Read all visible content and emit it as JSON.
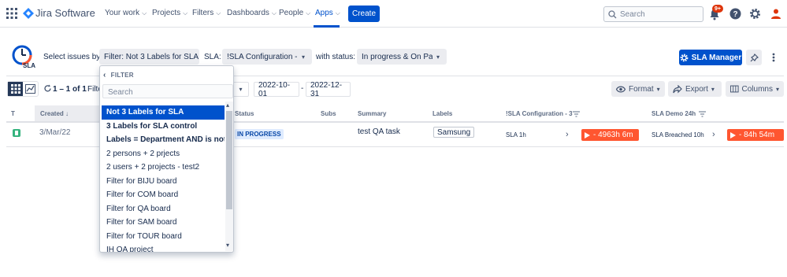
{
  "nav": {
    "app_name": "Jira Software",
    "items": [
      {
        "label": "Your work"
      },
      {
        "label": "Projects"
      },
      {
        "label": "Filters"
      },
      {
        "label": "Dashboards"
      },
      {
        "label": "People"
      },
      {
        "label": "Apps"
      }
    ],
    "create_label": "Create",
    "search_placeholder": "Search",
    "notification_badge": "9+",
    "brand_color": "#0052CC"
  },
  "toolbar": {
    "logo_text": "SLA",
    "select_issues_label": "Select issues by:",
    "filter_button": "Filter: Not 3 Labels for SLA",
    "sla_label": "SLA:",
    "sla_button": "!SLA Configuration - 3...",
    "with_status_label": "with status:",
    "status_button": "In progress & On Pau...",
    "sla_manager_label": "SLA Manager"
  },
  "subtoolbar": {
    "count_text": "1 – 1 of 1",
    "filter_text": "Filte",
    "date_from": "2022-10-01",
    "date_sep": "-",
    "date_to": "2022-12-31",
    "format_label": "Format",
    "export_label": "Export",
    "columns_label": "Columns"
  },
  "table": {
    "headers": {
      "t": "T",
      "created": "Created",
      "status": "Status",
      "subs": "Subs",
      "summary": "Summary",
      "labels": "Labels",
      "sla_config": "!SLA Configuration - 3",
      "sla_demo": "SLA Demo 24h"
    },
    "rows": [
      {
        "created": "3/Mar/22",
        "status": "IN PROGRESS",
        "summary": "test QA task",
        "label": "Samsung",
        "sla1_name": "SLA 1h",
        "sla1_value": "- 4963h 6m",
        "sla2_name": "SLA Breached 10h",
        "sla2_value": "- 84h 54m"
      }
    ]
  },
  "filter_panel": {
    "header": "FILTER",
    "search_placeholder": "Search",
    "items": [
      {
        "label": "Not 3 Labels for SLA",
        "selected": true
      },
      {
        "label": "3 Labels for SLA control",
        "bold": true
      },
      {
        "label": "Labels = Department AND is not E...",
        "bold": true
      },
      {
        "label": "2 persons + 2 prjects"
      },
      {
        "label": "2 users + 2 projects - test2"
      },
      {
        "label": "Filter for BIJU board"
      },
      {
        "label": "Filter for COM board"
      },
      {
        "label": "Filter for QA board"
      },
      {
        "label": "Filter for SAM board"
      },
      {
        "label": "Filter for TOUR board"
      },
      {
        "label": "IH QA project"
      }
    ]
  }
}
